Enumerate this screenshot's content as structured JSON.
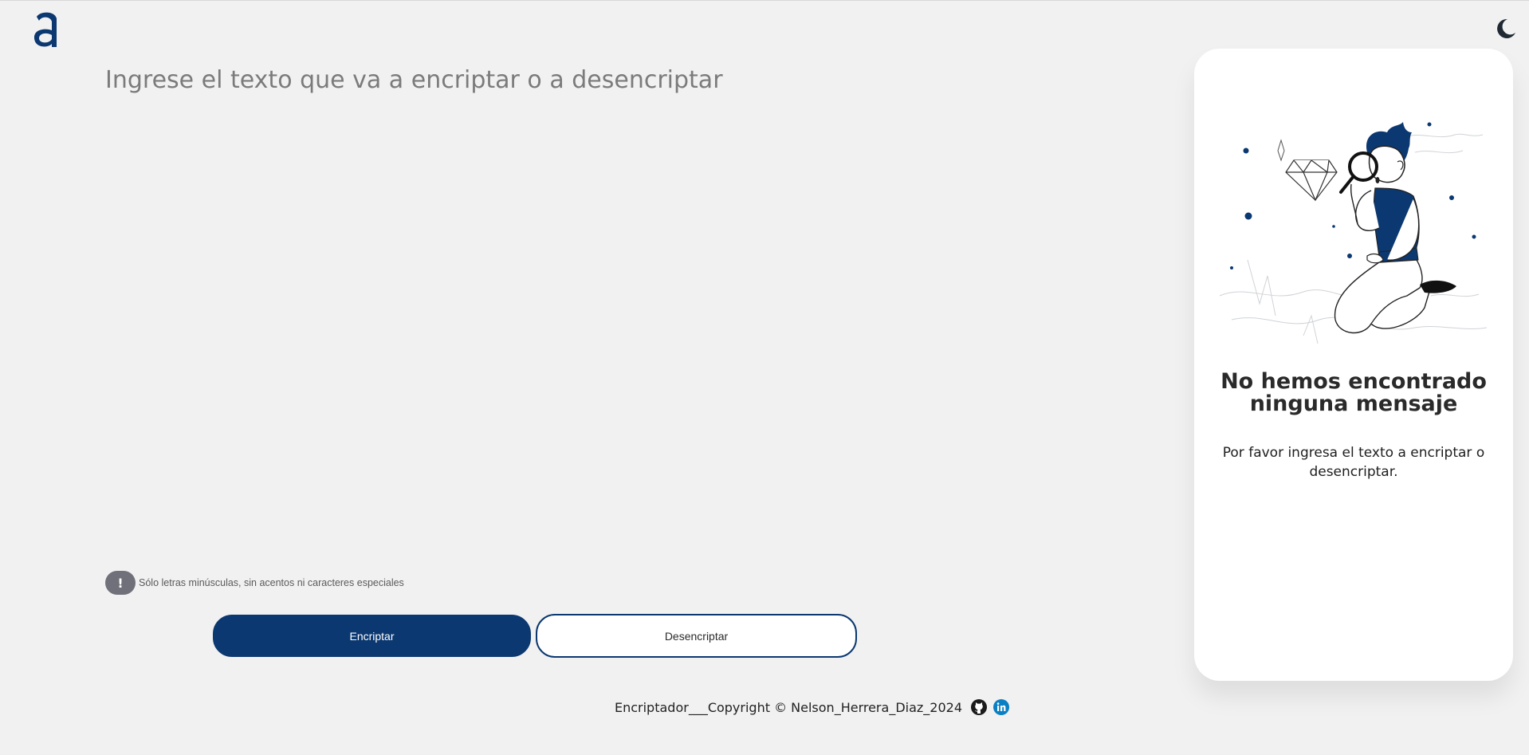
{
  "header": {
    "logo_icon": "alura-a-logo-icon",
    "theme_icon": "moon-icon"
  },
  "editor": {
    "placeholder": "Ingrese el texto que va a encriptar o a desencriptar",
    "value": ""
  },
  "warning": {
    "badge": "!",
    "text": "Sólo letras minúsculas, sin acentos ni caracteres especiales"
  },
  "buttons": {
    "encrypt_label": "Encriptar",
    "decrypt_label": "Desencriptar"
  },
  "footer": {
    "text": "Encriptador___Copyright © Nelson_Herrera_Diaz_2024",
    "github_icon": "github-icon",
    "linkedin_icon": "linkedin-icon"
  },
  "result_panel": {
    "illustration_icon": "person-with-magnifier-illustration",
    "title": "No hemos encontrado ninguna mensaje",
    "text": "Por favor ingresa el texto a encriptar o desencriptar."
  },
  "colors": {
    "background": "#f1f1f1",
    "primary": "#0b3870",
    "panel": "#ffffff",
    "badge": "#6f7079"
  }
}
